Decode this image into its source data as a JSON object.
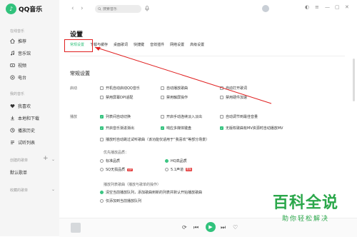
{
  "app": {
    "logo_text": "QQ音乐"
  },
  "sidebar": {
    "sections": {
      "online": "在线音乐",
      "mine": "我的音乐",
      "created": "创建的歌单",
      "collected": "收藏的歌单"
    },
    "online_items": [
      {
        "label": "推荐",
        "icon": "home-icon"
      },
      {
        "label": "音乐馆",
        "icon": "music-note-icon"
      },
      {
        "label": "视频",
        "icon": "video-icon"
      },
      {
        "label": "电台",
        "icon": "radio-icon"
      }
    ],
    "my_items": [
      {
        "label": "我喜欢",
        "icon": "heart-icon"
      },
      {
        "label": "本地和下载",
        "icon": "download-icon"
      },
      {
        "label": "播放历史",
        "icon": "history-icon"
      },
      {
        "label": "试听列表",
        "icon": "list-icon"
      }
    ],
    "created_playlist": "默认歌单",
    "plus_label": "+"
  },
  "topbar": {
    "search_placeholder": "搜索音乐",
    "back": "‹",
    "forward": "›",
    "user_name": "",
    "minimize": "—",
    "restore": "▢",
    "close": "✕"
  },
  "settings": {
    "title": "设置",
    "tabs": [
      "常规设置",
      "下载与缓存",
      "桌面歌词",
      "快捷键",
      "音效插件",
      "网络设置",
      "高级设置"
    ],
    "active_tab": 0,
    "section_title": "常规设置",
    "startup": {
      "label": "启动",
      "options": [
        {
          "label": "开机自动启动QQ音乐",
          "checked": false
        },
        {
          "label": "自动播放歌曲",
          "checked": false
        },
        {
          "label": "自动打开歌词",
          "checked": false
        },
        {
          "label": "禁用屏幕DPI适配",
          "checked": false
        },
        {
          "label": "禁用触屏操作",
          "checked": false
        },
        {
          "label": "禁用硬件加速",
          "checked": false
        }
      ]
    },
    "playback": {
      "label": "播放",
      "options": [
        {
          "label": "列表间自动切换",
          "checked": true
        },
        {
          "label": "开启手动连续淡入淡出",
          "checked": false
        },
        {
          "label": "自动调节到最佳音量",
          "checked": false
        },
        {
          "label": "开启音乐渐进渐出",
          "checked": true
        },
        {
          "label": "响应多媒体键盘",
          "checked": true
        },
        {
          "label": "无版权歌曲有MV资源时自动播放MV",
          "checked": true
        },
        {
          "label": "播放时自动跳过试听歌曲（该功能仅适用于“我喜欢”等部分场景）",
          "checked": false
        }
      ],
      "quality_label": "优先播放品质：",
      "quality_options": [
        {
          "label": "标准品质",
          "selected": false
        },
        {
          "label": "HQ高品质",
          "selected": true
        },
        {
          "label": "SQ无损品质",
          "selected": false
        },
        {
          "label": "5.1声道",
          "selected": false
        }
      ],
      "sq_badge": "VIP",
      "ch51_badge": "限免",
      "list_label": "播放列表歌曲（播放与歌单的操作）",
      "list_options": [
        {
          "label": "清空当前播放队列，添加歌曲到新的列表并默认开始播放歌曲",
          "selected": true
        },
        {
          "label": "仅添加到当前播放队列",
          "selected": false
        }
      ]
    }
  },
  "player": {
    "prev": "⏮",
    "play": "▶",
    "next": "⏭",
    "loop": "⟳"
  },
  "watermark": {
    "main": "百科全说",
    "sub": "助你轻松解决"
  },
  "colors": {
    "accent": "#31c27c",
    "highlight": "#e02020",
    "watermark": "#2aa74a"
  }
}
